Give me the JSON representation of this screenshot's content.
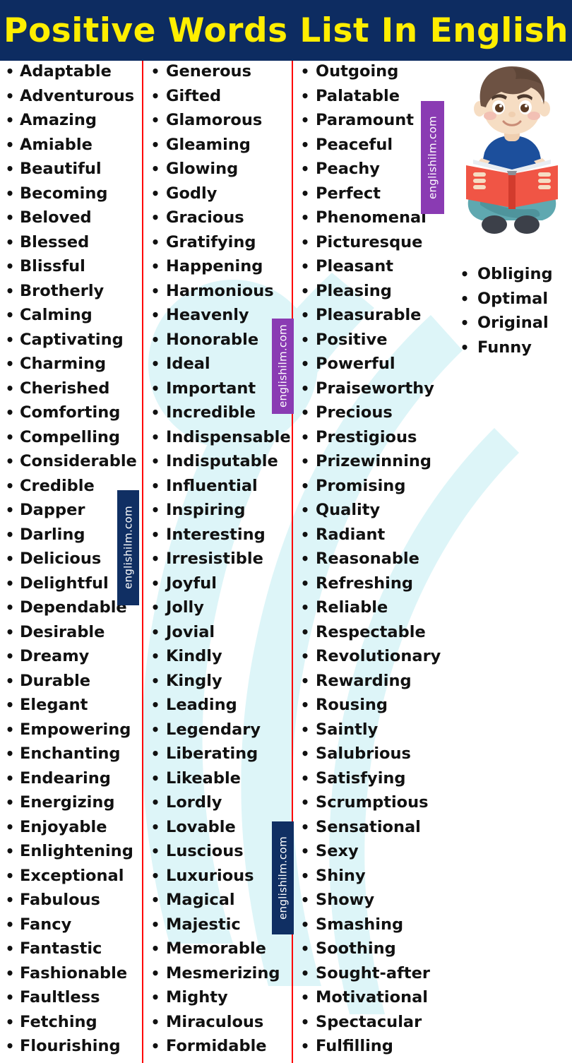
{
  "header": {
    "title": "Positive Words List In English",
    "background_color": "#0d2c61",
    "text_color": "#ffee00"
  },
  "theme": {
    "divider_color": "#ff0000",
    "word_color": "#111111",
    "swoosh_color": "#ddf5f8",
    "watermark_navy": "#102f63",
    "watermark_purple": "#8a3bb3",
    "bullet_glyph": "•"
  },
  "watermarks": [
    {
      "text": "englishilm.com",
      "style": "navy"
    },
    {
      "text": "englishilm.com",
      "style": "purple"
    },
    {
      "text": "englishilm.com",
      "style": "purple"
    },
    {
      "text": "englishilm.com",
      "style": "navy"
    }
  ],
  "illustration": {
    "name": "boy-reading-book",
    "hair_color": "#6d5243",
    "skin_color": "#f6ddc3",
    "shirt_color": "#1c4f9c",
    "pants_color": "#5fa8b0",
    "book_color": "#f05545",
    "shoe_color": "#3c4049"
  },
  "columns": [
    {
      "id": "column-1",
      "words": [
        "Adaptable",
        "Adventurous",
        "Amazing",
        "Amiable",
        "Beautiful",
        "Becoming",
        "Beloved",
        "Blessed",
        "Blissful",
        "Brotherly",
        "Calming",
        "Captivating",
        "Charming",
        "Cherished",
        "Comforting",
        "Compelling",
        "Considerable",
        "Credible",
        "Dapper",
        "Darling",
        "Delicious",
        "Delightful",
        "Dependable",
        "Desirable",
        "Dreamy",
        "Durable",
        "Elegant",
        "Empowering",
        "Enchanting",
        "Endearing",
        "Energizing",
        "Enjoyable",
        "Enlightening",
        "Exceptional",
        "Fabulous",
        "Fancy",
        "Fantastic",
        "Fashionable",
        "Faultless",
        "Fetching",
        "Flourishing"
      ]
    },
    {
      "id": "column-2",
      "words": [
        "Generous",
        "Gifted",
        "Glamorous",
        "Gleaming",
        "Glowing",
        "Godly",
        "Gracious",
        "Gratifying",
        "Happening",
        "Harmonious",
        "Heavenly",
        "Honorable",
        "Ideal",
        "Important",
        "Incredible",
        "Indispensable",
        "Indisputable",
        "Influential",
        "Inspiring",
        "Interesting",
        "Irresistible",
        "Joyful",
        "Jolly",
        "Jovial",
        "Kindly",
        "Kingly",
        "Leading",
        "Legendary",
        "Liberating",
        "Likeable",
        "Lordly",
        "Lovable",
        "Luscious",
        "Luxurious",
        "Magical",
        "Majestic",
        "Memorable",
        "Mesmerizing",
        "Mighty",
        "Miraculous",
        "Formidable"
      ]
    },
    {
      "id": "column-3",
      "words": [
        "Outgoing",
        "Palatable",
        "Paramount",
        "Peaceful",
        "Peachy",
        "Perfect",
        "Phenomenal",
        "Picturesque",
        "Pleasant",
        "Pleasing",
        "Pleasurable",
        "Positive",
        "Powerful",
        "Praiseworthy",
        "Precious",
        "Prestigious",
        "Prizewinning",
        "Promising",
        "Quality",
        "Radiant",
        "Reasonable",
        "Refreshing",
        "Reliable",
        "Respectable",
        "Revolutionary",
        "Rewarding",
        "Rousing",
        "Saintly",
        "Salubrious",
        "Satisfying",
        "Scrumptious",
        "Sensational",
        "Sexy",
        "Shiny",
        "Showy",
        "Smashing",
        "Soothing",
        "Sought-after",
        "Motivational",
        "Spectacular",
        "Fulfilling"
      ]
    },
    {
      "id": "column-4",
      "words": [
        "Obliging",
        "Optimal",
        "Original",
        "Funny"
      ]
    }
  ]
}
